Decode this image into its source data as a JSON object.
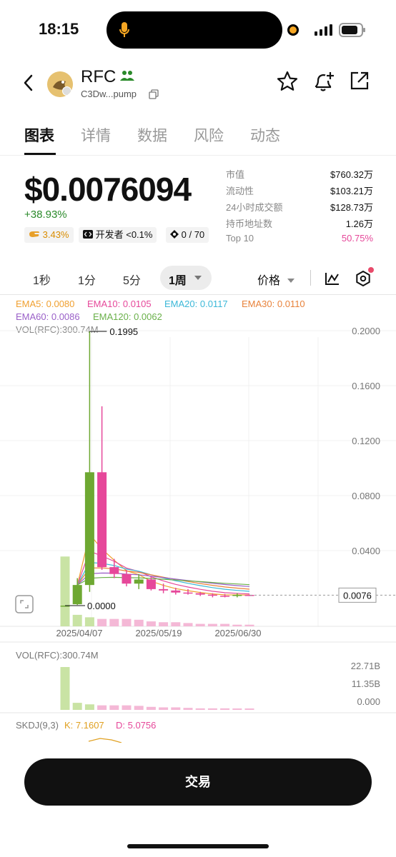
{
  "status": {
    "time": "18:15"
  },
  "token": {
    "symbol": "RFC",
    "address": "C3Dw...pump"
  },
  "tabs": [
    "图表",
    "详情",
    "数据",
    "风险",
    "动态"
  ],
  "price": {
    "value": "$0.0076094",
    "change": "+38.93%"
  },
  "chips": {
    "snipers": "3.43%",
    "dev": "开发者 <0.1%",
    "holders_ratio": "0 / 70"
  },
  "stats": [
    {
      "label": "市值",
      "value": "$760.32万"
    },
    {
      "label": "流动性",
      "value": "$103.21万"
    },
    {
      "label": "24小时成交额",
      "value": "$128.73万"
    },
    {
      "label": "持币地址数",
      "value": "1.26万"
    },
    {
      "label": "Top 10",
      "value": "50.75%"
    }
  ],
  "timeframes": [
    "1秒",
    "1分",
    "5分"
  ],
  "timeframe_active": "1周",
  "indicator": "价格",
  "ema": {
    "ema5": "EMA5: 0.0080",
    "ema10": "EMA10: 0.0105",
    "ema20": "EMA20: 0.0117",
    "ema30": "EMA30: 0.0110",
    "ema60": "EMA60: 0.0086",
    "ema120": "EMA120: 0.0062",
    "vol_label": "VOL(RFC):300.74M"
  },
  "colors": {
    "up": "#6ea832",
    "down": "#e6489a",
    "top10": "#e6489a"
  },
  "chart_data": {
    "type": "candlestick",
    "price_axis_labels": [
      "0.2000",
      "0.1600",
      "0.1200",
      "0.0800",
      "0.0400"
    ],
    "current_price_label": "0.0076",
    "high_annotation": "0.1995",
    "low_annotation": "0.0000",
    "date_labels": [
      "2025/04/07",
      "2025/05/19",
      "2025/06/30"
    ],
    "candles": [
      {
        "o": 0.0,
        "h": 0.0,
        "l": 0.0,
        "c": 0.0
      },
      {
        "o": 0.001,
        "h": 0.02,
        "l": 0.0005,
        "c": 0.015
      },
      {
        "o": 0.015,
        "h": 0.1995,
        "l": 0.01,
        "c": 0.097
      },
      {
        "o": 0.097,
        "h": 0.145,
        "l": 0.026,
        "c": 0.028
      },
      {
        "o": 0.028,
        "h": 0.034,
        "l": 0.02,
        "c": 0.023
      },
      {
        "o": 0.023,
        "h": 0.026,
        "l": 0.014,
        "c": 0.016
      },
      {
        "o": 0.016,
        "h": 0.023,
        "l": 0.012,
        "c": 0.019
      },
      {
        "o": 0.019,
        "h": 0.021,
        "l": 0.011,
        "c": 0.012
      },
      {
        "o": 0.012,
        "h": 0.016,
        "l": 0.009,
        "c": 0.011
      },
      {
        "o": 0.011,
        "h": 0.013,
        "l": 0.008,
        "c": 0.0095
      },
      {
        "o": 0.0095,
        "h": 0.012,
        "l": 0.008,
        "c": 0.009
      },
      {
        "o": 0.009,
        "h": 0.01,
        "l": 0.007,
        "c": 0.008
      },
      {
        "o": 0.008,
        "h": 0.009,
        "l": 0.006,
        "c": 0.0072
      },
      {
        "o": 0.0072,
        "h": 0.0085,
        "l": 0.006,
        "c": 0.007
      },
      {
        "o": 0.007,
        "h": 0.009,
        "l": 0.006,
        "c": 0.0078
      },
      {
        "o": 0.0078,
        "h": 0.008,
        "l": 0.007,
        "c": 0.0076
      }
    ],
    "volume_panel": {
      "label": "VOL(RFC):300.74M",
      "axis_labels": [
        "22.71B",
        "11.35B",
        "0.000"
      ]
    },
    "skdj": {
      "label": "SKDJ(9,3)",
      "k": "K: 7.1607",
      "d": "D: 5.0756"
    }
  },
  "trade_button": "交易"
}
